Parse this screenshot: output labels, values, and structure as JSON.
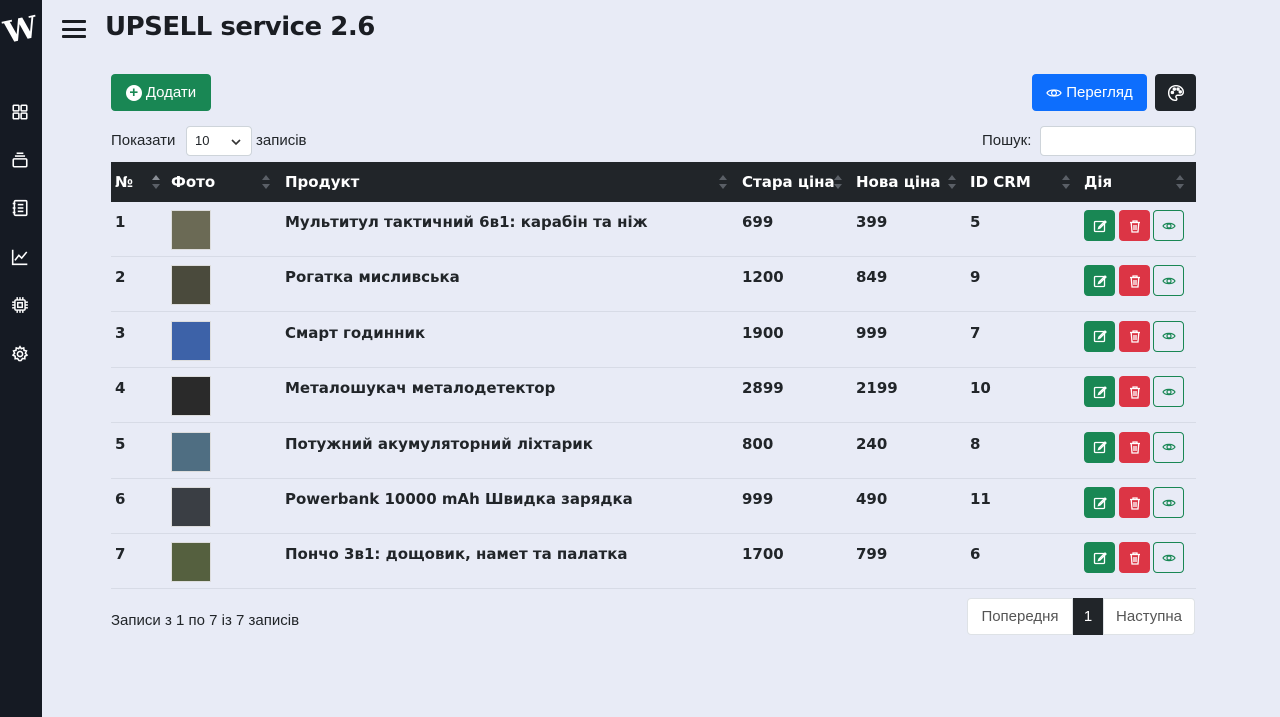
{
  "app": {
    "logo_text": "W",
    "title": "UPSELL service 2.6"
  },
  "sidebar": {
    "icons": [
      "dashboard-icon",
      "layers-icon",
      "journal-icon",
      "chart-icon",
      "cpu-icon",
      "gear-icon"
    ]
  },
  "toolbar": {
    "add_label": "Додати",
    "view_label": "Перегляд"
  },
  "length": {
    "show_label": "Показати",
    "value": "10",
    "records_label": "записів"
  },
  "search": {
    "label": "Пошук:",
    "value": ""
  },
  "table": {
    "headers": [
      "№",
      "Фото",
      "Продукт",
      "Стара ціна",
      "Нова ціна",
      "ID CRM",
      "Дія"
    ],
    "rows": [
      {
        "num": "1",
        "product": "Мультитул тактичний 6в1: карабін та ніж",
        "old_price": "699",
        "new_price": "399",
        "crm_id": "5",
        "photo_color": "#6b6a55"
      },
      {
        "num": "2",
        "product": "Рогатка мисливська",
        "old_price": "1200",
        "new_price": "849",
        "crm_id": "9",
        "photo_color": "#4a4a3c"
      },
      {
        "num": "3",
        "product": "Смарт годинник",
        "old_price": "1900",
        "new_price": "999",
        "crm_id": "7",
        "photo_color": "#3d62a8"
      },
      {
        "num": "4",
        "product": "Металошукач металодетектор",
        "old_price": "2899",
        "new_price": "2199",
        "crm_id": "10",
        "photo_color": "#2a2a2a"
      },
      {
        "num": "5",
        "product": "Потужний акумуляторний ліхтарик",
        "old_price": "800",
        "new_price": "240",
        "crm_id": "8",
        "photo_color": "#4f6e82"
      },
      {
        "num": "6",
        "product": "Powerbank 10000 mAh Швидка зарядка",
        "old_price": "999",
        "new_price": "490",
        "crm_id": "11",
        "photo_color": "#3a3e44"
      },
      {
        "num": "7",
        "product": "Пончо 3в1: дощовик, намет та палатка",
        "old_price": "1700",
        "new_price": "799",
        "crm_id": "6",
        "photo_color": "#55603f"
      }
    ]
  },
  "footer": {
    "info": "Записи з 1 по 7 із 7 записів",
    "prev_label": "Попередня",
    "current_page": "1",
    "next_label": "Наступна"
  },
  "colors": {
    "success": "#198754",
    "danger": "#dc3545",
    "primary": "#0d6efd",
    "dark": "#212529"
  }
}
